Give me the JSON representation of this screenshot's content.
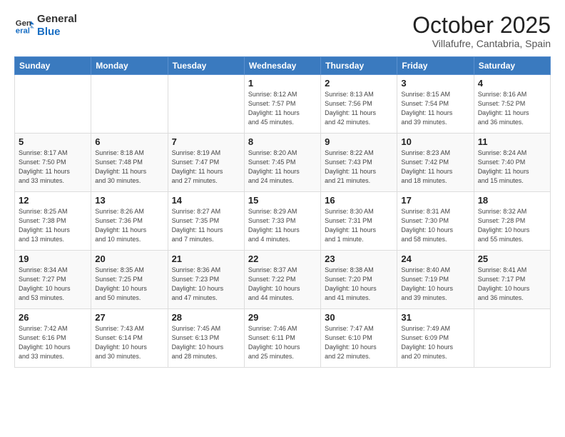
{
  "header": {
    "logo_line1": "General",
    "logo_line2": "Blue",
    "month": "October 2025",
    "location": "Villafufre, Cantabria, Spain"
  },
  "weekdays": [
    "Sunday",
    "Monday",
    "Tuesday",
    "Wednesday",
    "Thursday",
    "Friday",
    "Saturday"
  ],
  "weeks": [
    [
      {
        "day": "",
        "info": ""
      },
      {
        "day": "",
        "info": ""
      },
      {
        "day": "",
        "info": ""
      },
      {
        "day": "1",
        "info": "Sunrise: 8:12 AM\nSunset: 7:57 PM\nDaylight: 11 hours\nand 45 minutes."
      },
      {
        "day": "2",
        "info": "Sunrise: 8:13 AM\nSunset: 7:56 PM\nDaylight: 11 hours\nand 42 minutes."
      },
      {
        "day": "3",
        "info": "Sunrise: 8:15 AM\nSunset: 7:54 PM\nDaylight: 11 hours\nand 39 minutes."
      },
      {
        "day": "4",
        "info": "Sunrise: 8:16 AM\nSunset: 7:52 PM\nDaylight: 11 hours\nand 36 minutes."
      }
    ],
    [
      {
        "day": "5",
        "info": "Sunrise: 8:17 AM\nSunset: 7:50 PM\nDaylight: 11 hours\nand 33 minutes."
      },
      {
        "day": "6",
        "info": "Sunrise: 8:18 AM\nSunset: 7:48 PM\nDaylight: 11 hours\nand 30 minutes."
      },
      {
        "day": "7",
        "info": "Sunrise: 8:19 AM\nSunset: 7:47 PM\nDaylight: 11 hours\nand 27 minutes."
      },
      {
        "day": "8",
        "info": "Sunrise: 8:20 AM\nSunset: 7:45 PM\nDaylight: 11 hours\nand 24 minutes."
      },
      {
        "day": "9",
        "info": "Sunrise: 8:22 AM\nSunset: 7:43 PM\nDaylight: 11 hours\nand 21 minutes."
      },
      {
        "day": "10",
        "info": "Sunrise: 8:23 AM\nSunset: 7:42 PM\nDaylight: 11 hours\nand 18 minutes."
      },
      {
        "day": "11",
        "info": "Sunrise: 8:24 AM\nSunset: 7:40 PM\nDaylight: 11 hours\nand 15 minutes."
      }
    ],
    [
      {
        "day": "12",
        "info": "Sunrise: 8:25 AM\nSunset: 7:38 PM\nDaylight: 11 hours\nand 13 minutes."
      },
      {
        "day": "13",
        "info": "Sunrise: 8:26 AM\nSunset: 7:36 PM\nDaylight: 11 hours\nand 10 minutes."
      },
      {
        "day": "14",
        "info": "Sunrise: 8:27 AM\nSunset: 7:35 PM\nDaylight: 11 hours\nand 7 minutes."
      },
      {
        "day": "15",
        "info": "Sunrise: 8:29 AM\nSunset: 7:33 PM\nDaylight: 11 hours\nand 4 minutes."
      },
      {
        "day": "16",
        "info": "Sunrise: 8:30 AM\nSunset: 7:31 PM\nDaylight: 11 hours\nand 1 minute."
      },
      {
        "day": "17",
        "info": "Sunrise: 8:31 AM\nSunset: 7:30 PM\nDaylight: 10 hours\nand 58 minutes."
      },
      {
        "day": "18",
        "info": "Sunrise: 8:32 AM\nSunset: 7:28 PM\nDaylight: 10 hours\nand 55 minutes."
      }
    ],
    [
      {
        "day": "19",
        "info": "Sunrise: 8:34 AM\nSunset: 7:27 PM\nDaylight: 10 hours\nand 53 minutes."
      },
      {
        "day": "20",
        "info": "Sunrise: 8:35 AM\nSunset: 7:25 PM\nDaylight: 10 hours\nand 50 minutes."
      },
      {
        "day": "21",
        "info": "Sunrise: 8:36 AM\nSunset: 7:23 PM\nDaylight: 10 hours\nand 47 minutes."
      },
      {
        "day": "22",
        "info": "Sunrise: 8:37 AM\nSunset: 7:22 PM\nDaylight: 10 hours\nand 44 minutes."
      },
      {
        "day": "23",
        "info": "Sunrise: 8:38 AM\nSunset: 7:20 PM\nDaylight: 10 hours\nand 41 minutes."
      },
      {
        "day": "24",
        "info": "Sunrise: 8:40 AM\nSunset: 7:19 PM\nDaylight: 10 hours\nand 39 minutes."
      },
      {
        "day": "25",
        "info": "Sunrise: 8:41 AM\nSunset: 7:17 PM\nDaylight: 10 hours\nand 36 minutes."
      }
    ],
    [
      {
        "day": "26",
        "info": "Sunrise: 7:42 AM\nSunset: 6:16 PM\nDaylight: 10 hours\nand 33 minutes."
      },
      {
        "day": "27",
        "info": "Sunrise: 7:43 AM\nSunset: 6:14 PM\nDaylight: 10 hours\nand 30 minutes."
      },
      {
        "day": "28",
        "info": "Sunrise: 7:45 AM\nSunset: 6:13 PM\nDaylight: 10 hours\nand 28 minutes."
      },
      {
        "day": "29",
        "info": "Sunrise: 7:46 AM\nSunset: 6:11 PM\nDaylight: 10 hours\nand 25 minutes."
      },
      {
        "day": "30",
        "info": "Sunrise: 7:47 AM\nSunset: 6:10 PM\nDaylight: 10 hours\nand 22 minutes."
      },
      {
        "day": "31",
        "info": "Sunrise: 7:49 AM\nSunset: 6:09 PM\nDaylight: 10 hours\nand 20 minutes."
      },
      {
        "day": "",
        "info": ""
      }
    ]
  ]
}
